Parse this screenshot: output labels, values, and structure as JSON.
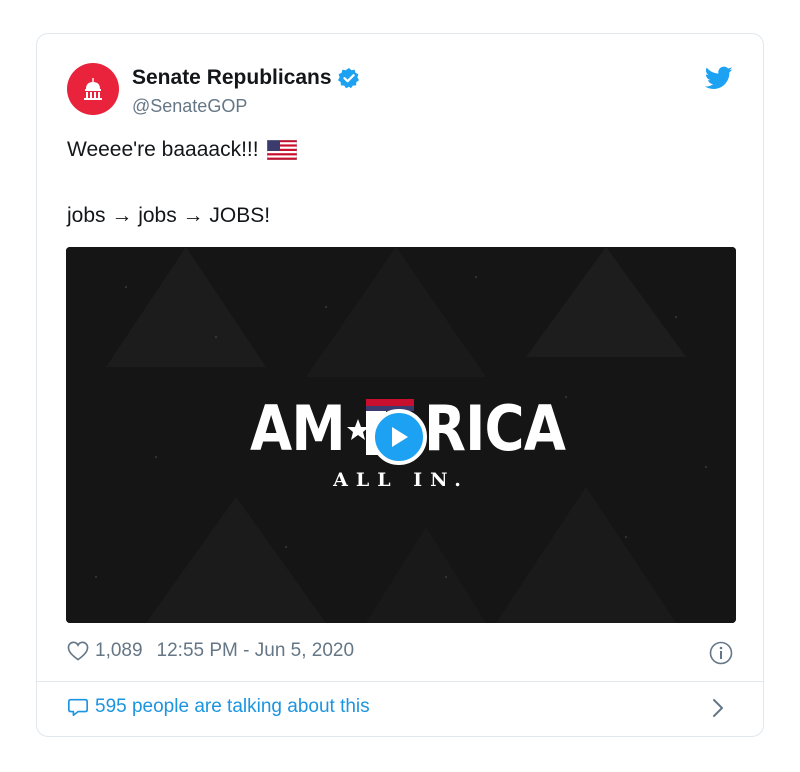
{
  "tweet": {
    "display_name": "Senate Republicans",
    "handle": "@SenateGOP",
    "verified_icon": "verified-badge-icon",
    "avatar_icon": "capitol-dome-icon",
    "brand_icon": "twitter-bird-icon",
    "text_line1": "Weeee're baaaack!!!",
    "flag_emoji": "us-flag-icon",
    "text_line2": "jobs → jobs → JOBS!",
    "media": {
      "title_left": "AM",
      "title_right": "RICA",
      "tagline": "ALL IN.",
      "play_icon": "play-icon"
    },
    "likes": "1,089",
    "timestamp": "12:55 PM - Jun 5, 2020",
    "talking": "595 people are talking about this"
  },
  "colors": {
    "accent": "#1da1f2",
    "avatar_red": "#e8233b",
    "link_blue": "#1b95e0",
    "muted": "#657786"
  }
}
